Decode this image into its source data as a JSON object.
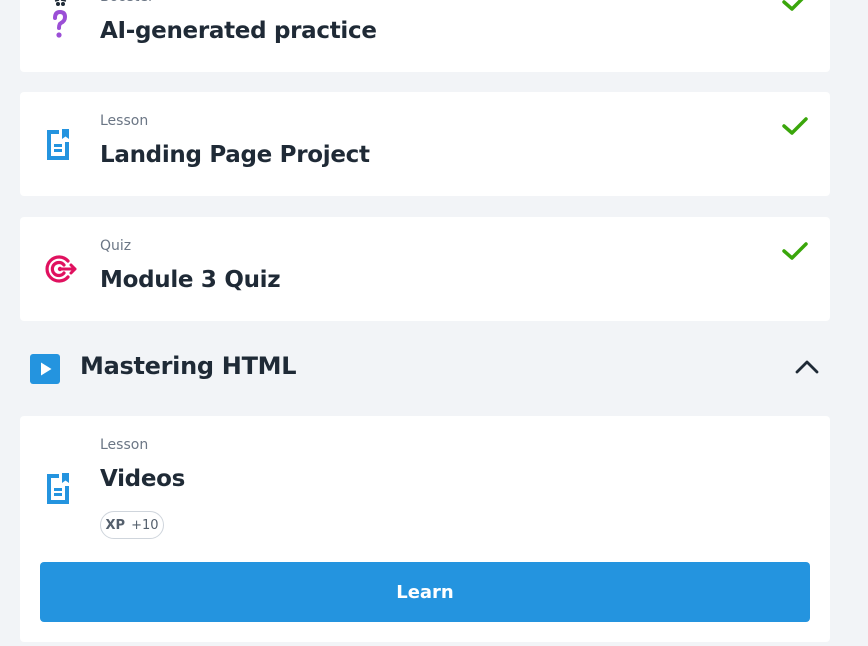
{
  "cards": [
    {
      "kind": "Booster",
      "title": "AI-generated practice",
      "icon": "question-icon",
      "completed": true
    },
    {
      "kind": "Lesson",
      "title": "Landing Page Project",
      "icon": "document-icon",
      "completed": true
    },
    {
      "kind": "Quiz",
      "title": "Module 3 Quiz",
      "icon": "target-icon",
      "completed": true
    }
  ],
  "section": {
    "title": "Mastering HTML",
    "icon": "play-icon",
    "expanded": true
  },
  "active_lesson": {
    "kind": "Lesson",
    "title": "Videos",
    "icon": "document-icon",
    "xp_label": "XP",
    "xp_value": "+10",
    "button_label": "Learn"
  },
  "colors": {
    "background": "#f2f4f7",
    "card": "#ffffff",
    "check": "#3aa60b",
    "doc_icon": "#2494df",
    "target_icon": "#e0115f",
    "question_icon": "#9b4fd6",
    "button": "#2494df"
  }
}
